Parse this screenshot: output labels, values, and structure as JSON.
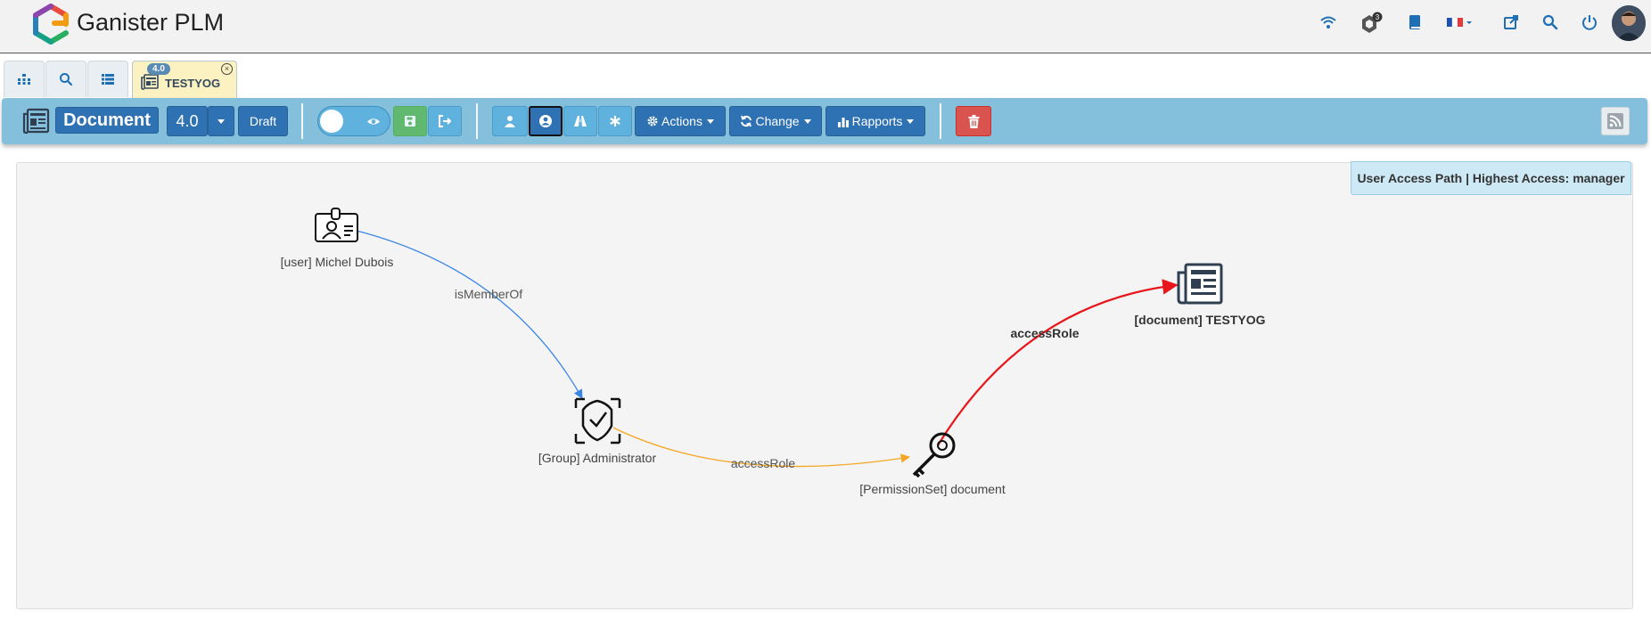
{
  "app": {
    "title": "Ganister PLM"
  },
  "topnav": {
    "icons": [
      "wifi-icon",
      "ganister-badge-icon",
      "book-icon",
      "french-flag-icon",
      "external-link-icon",
      "search-icon",
      "power-icon"
    ],
    "badge_count": "3"
  },
  "tabs": {
    "open_item": {
      "label": "TESTYOG",
      "revision_badge": "4.0"
    }
  },
  "toolbar": {
    "type_label": "Document",
    "revision": "4.0",
    "state": "Draft",
    "actions_label": "Actions",
    "change_label": "Change",
    "rapports_label": "Rapports"
  },
  "graph": {
    "title": "User Access Path | Highest Access: manager",
    "nodes": [
      {
        "id": "user",
        "label": "[user] Michel Dubois",
        "icon": "user-badge-icon"
      },
      {
        "id": "group",
        "label": "[Group] Administrator",
        "icon": "shield-check-icon"
      },
      {
        "id": "permset",
        "label": "[PermissionSet] document",
        "icon": "key-icon"
      },
      {
        "id": "doc",
        "label": "[document] TESTYOG",
        "icon": "document-icon"
      }
    ],
    "edges": [
      {
        "from": "user",
        "to": "group",
        "label": "isMemberOf",
        "color": "#3a86e6"
      },
      {
        "from": "group",
        "to": "permset",
        "label": "accessRole",
        "color": "#f5a623"
      },
      {
        "from": "permset",
        "to": "doc",
        "label": "accessRole",
        "color": "#e8161b"
      }
    ]
  },
  "colors": {
    "toolbar": "#84bfdc",
    "primary": "#2f72b3",
    "draft_tab": "#fbf1c1",
    "delete": "#d9534f"
  }
}
